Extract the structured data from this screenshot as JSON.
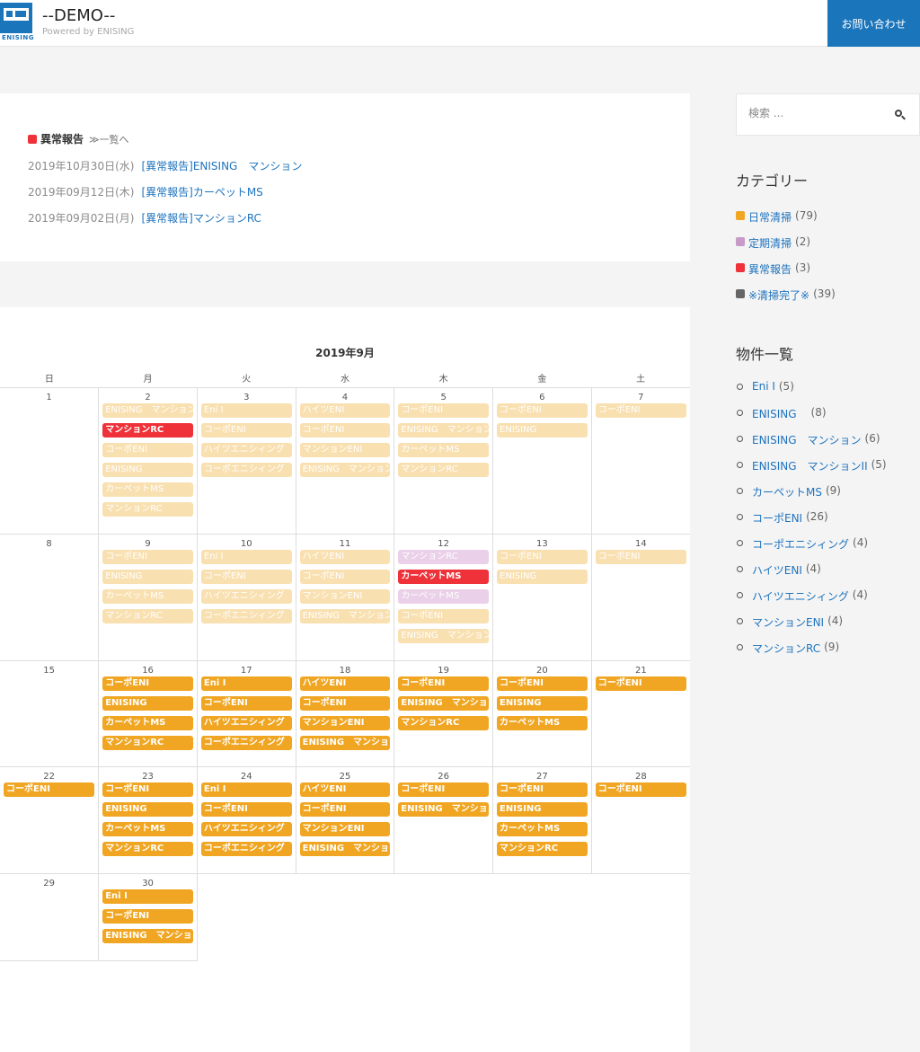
{
  "header": {
    "logo_text": "ENISING",
    "site_title": "--DEMO--",
    "site_subtitle": "Powered by ENISING",
    "contact_label": "お問い合わせ"
  },
  "report": {
    "title": "異常報告",
    "more_label": "≫一覧へ",
    "color": "#ef3139",
    "items": [
      {
        "date": "2019年10月30日(水)",
        "title": "[異常報告]ENISING　マンション"
      },
      {
        "date": "2019年09月12日(木)",
        "title": "[異常報告]カーペットMS"
      },
      {
        "date": "2019年09月02日(月)",
        "title": "[異常報告]マンションRC"
      }
    ]
  },
  "calendar": {
    "title": "2019年9月",
    "weekdays": [
      "日",
      "月",
      "火",
      "水",
      "木",
      "金",
      "土"
    ],
    "weeks": [
      [
        {
          "day": "1",
          "events": []
        },
        {
          "day": "2",
          "events": [
            {
              "t": "ENISING　マンション",
              "s": "lt"
            },
            {
              "t": "マンションRC",
              "s": "rd"
            },
            {
              "t": "コーポENI",
              "s": "lt"
            },
            {
              "t": "ENISING",
              "s": "lt"
            },
            {
              "t": "カーペットMS",
              "s": "lt"
            },
            {
              "t": "マンションRC",
              "s": "lt"
            }
          ]
        },
        {
          "day": "3",
          "events": [
            {
              "t": "Eni I",
              "s": "lt"
            },
            {
              "t": "コーポENI",
              "s": "lt"
            },
            {
              "t": "ハイツエニシィング",
              "s": "lt"
            },
            {
              "t": "コーポエニシィング",
              "s": "lt"
            }
          ]
        },
        {
          "day": "4",
          "events": [
            {
              "t": "ハイツENI",
              "s": "lt"
            },
            {
              "t": "コーポENI",
              "s": "lt"
            },
            {
              "t": "マンションENI",
              "s": "lt"
            },
            {
              "t": "ENISING　マンション",
              "s": "lt"
            }
          ]
        },
        {
          "day": "5",
          "events": [
            {
              "t": "コーポENI",
              "s": "lt"
            },
            {
              "t": "ENISING　マンション",
              "s": "lt"
            },
            {
              "t": "カーペットMS",
              "s": "lt"
            },
            {
              "t": "マンションRC",
              "s": "lt"
            }
          ]
        },
        {
          "day": "6",
          "events": [
            {
              "t": "コーポENI",
              "s": "lt"
            },
            {
              "t": "ENISING",
              "s": "lt"
            }
          ]
        },
        {
          "day": "7",
          "events": [
            {
              "t": "コーポENI",
              "s": "lt"
            }
          ]
        }
      ],
      [
        {
          "day": "8",
          "events": []
        },
        {
          "day": "9",
          "events": [
            {
              "t": "コーポENI",
              "s": "lt"
            },
            {
              "t": "ENISING",
              "s": "lt"
            },
            {
              "t": "カーペットMS",
              "s": "lt"
            },
            {
              "t": "マンションRC",
              "s": "lt"
            }
          ]
        },
        {
          "day": "10",
          "events": [
            {
              "t": "Eni I",
              "s": "lt"
            },
            {
              "t": "コーポENI",
              "s": "lt"
            },
            {
              "t": "ハイツエニシィング",
              "s": "lt"
            },
            {
              "t": "コーポエニシィング",
              "s": "lt"
            }
          ]
        },
        {
          "day": "11",
          "events": [
            {
              "t": "ハイツENI",
              "s": "lt"
            },
            {
              "t": "コーポENI",
              "s": "lt"
            },
            {
              "t": "マンションENI",
              "s": "lt"
            },
            {
              "t": "ENISING　マンション",
              "s": "lt"
            }
          ]
        },
        {
          "day": "12",
          "events": [
            {
              "t": "マンションRC",
              "s": "pk"
            },
            {
              "t": "カーペットMS",
              "s": "rd"
            },
            {
              "t": "カーペットMS",
              "s": "pk"
            },
            {
              "t": "コーポENI",
              "s": "lt"
            },
            {
              "t": "ENISING　マンション",
              "s": "lt"
            }
          ]
        },
        {
          "day": "13",
          "events": [
            {
              "t": "コーポENI",
              "s": "lt"
            },
            {
              "t": "ENISING",
              "s": "lt"
            }
          ]
        },
        {
          "day": "14",
          "events": [
            {
              "t": "コーポENI",
              "s": "lt"
            }
          ]
        }
      ],
      [
        {
          "day": "15",
          "events": []
        },
        {
          "day": "16",
          "events": [
            {
              "t": "コーポENI",
              "s": "dk"
            },
            {
              "t": "ENISING",
              "s": "dk"
            },
            {
              "t": "カーペットMS",
              "s": "dk"
            },
            {
              "t": "マンションRC",
              "s": "dk"
            }
          ]
        },
        {
          "day": "17",
          "events": [
            {
              "t": "Eni I",
              "s": "dk"
            },
            {
              "t": "コーポENI",
              "s": "dk"
            },
            {
              "t": "ハイツエニシィング",
              "s": "dk"
            },
            {
              "t": "コーポエニシィング",
              "s": "dk"
            }
          ]
        },
        {
          "day": "18",
          "events": [
            {
              "t": "ハイツENI",
              "s": "dk"
            },
            {
              "t": "コーポENI",
              "s": "dk"
            },
            {
              "t": "マンションENI",
              "s": "dk"
            },
            {
              "t": "ENISING　マンション",
              "s": "dk"
            }
          ]
        },
        {
          "day": "19",
          "events": [
            {
              "t": "コーポENI",
              "s": "dk"
            },
            {
              "t": "ENISING　マンション",
              "s": "dk"
            },
            {
              "t": "マンションRC",
              "s": "dk"
            }
          ]
        },
        {
          "day": "20",
          "events": [
            {
              "t": "コーポENI",
              "s": "dk"
            },
            {
              "t": "ENISING",
              "s": "dk"
            },
            {
              "t": "カーペットMS",
              "s": "dk"
            }
          ]
        },
        {
          "day": "21",
          "events": [
            {
              "t": "コーポENI",
              "s": "dk"
            }
          ]
        }
      ],
      [
        {
          "day": "22",
          "events": [
            {
              "t": "コーポENI",
              "s": "dk"
            }
          ]
        },
        {
          "day": "23",
          "events": [
            {
              "t": "コーポENI",
              "s": "dk"
            },
            {
              "t": "ENISING",
              "s": "dk"
            },
            {
              "t": "カーペットMS",
              "s": "dk"
            },
            {
              "t": "マンションRC",
              "s": "dk"
            }
          ]
        },
        {
          "day": "24",
          "events": [
            {
              "t": "Eni I",
              "s": "dk"
            },
            {
              "t": "コーポENI",
              "s": "dk"
            },
            {
              "t": "ハイツエニシィング",
              "s": "dk"
            },
            {
              "t": "コーポエニシィング",
              "s": "dk"
            }
          ]
        },
        {
          "day": "25",
          "events": [
            {
              "t": "ハイツENI",
              "s": "dk"
            },
            {
              "t": "コーポENI",
              "s": "dk"
            },
            {
              "t": "マンションENI",
              "s": "dk"
            },
            {
              "t": "ENISING　マンション",
              "s": "dk"
            }
          ]
        },
        {
          "day": "26",
          "events": [
            {
              "t": "コーポENI",
              "s": "dk"
            },
            {
              "t": "ENISING　マンション",
              "s": "dk"
            }
          ]
        },
        {
          "day": "27",
          "events": [
            {
              "t": "コーポENI",
              "s": "dk"
            },
            {
              "t": "ENISING",
              "s": "dk"
            },
            {
              "t": "カーペットMS",
              "s": "dk"
            },
            {
              "t": "マンションRC",
              "s": "dk"
            }
          ]
        },
        {
          "day": "28",
          "events": [
            {
              "t": "コーポENI",
              "s": "dk"
            }
          ]
        }
      ],
      [
        {
          "day": "29",
          "events": []
        },
        {
          "day": "30",
          "events": [
            {
              "t": "Eni I",
              "s": "dk"
            },
            {
              "t": "コーポENI",
              "s": "dk"
            },
            {
              "t": "ENISING　マンション",
              "s": "dk"
            }
          ]
        },
        null,
        null,
        null,
        null,
        null
      ]
    ]
  },
  "sidebar": {
    "search_placeholder": "検索 ...",
    "categories_heading": "カテゴリー",
    "categories": [
      {
        "label": "日常清掃",
        "count": "(79)",
        "color": "#f0a622"
      },
      {
        "label": "定期清掃",
        "count": "(2)",
        "color": "#c89ac8"
      },
      {
        "label": "異常報告",
        "count": "(3)",
        "color": "#ef3139"
      },
      {
        "label": "※清掃完了※",
        "count": "(39)",
        "color": "#666666"
      }
    ],
    "properties_heading": "物件一覧",
    "properties": [
      {
        "label": "Eni I",
        "count": "(5)"
      },
      {
        "label": "ENISING　",
        "count": "(8)"
      },
      {
        "label": "ENISING　マンション",
        "count": "(6)"
      },
      {
        "label": "ENISING　マンションII",
        "count": "(5)"
      },
      {
        "label": "カーペットMS",
        "count": "(9)"
      },
      {
        "label": "コーポENI",
        "count": "(26)"
      },
      {
        "label": "コーポエニシィング",
        "count": "(4)"
      },
      {
        "label": "ハイツENI",
        "count": "(4)"
      },
      {
        "label": "ハイツエニシィング",
        "count": "(4)"
      },
      {
        "label": "マンションENI",
        "count": "(4)"
      },
      {
        "label": "マンションRC",
        "count": "(9)"
      }
    ]
  },
  "colors": {
    "brand": "#1b75bb",
    "link": "#1e73be",
    "event_light": "#f9e0b1",
    "event_dark": "#f0a622",
    "event_pink": "#ead0e9",
    "event_red": "#ef3139"
  }
}
